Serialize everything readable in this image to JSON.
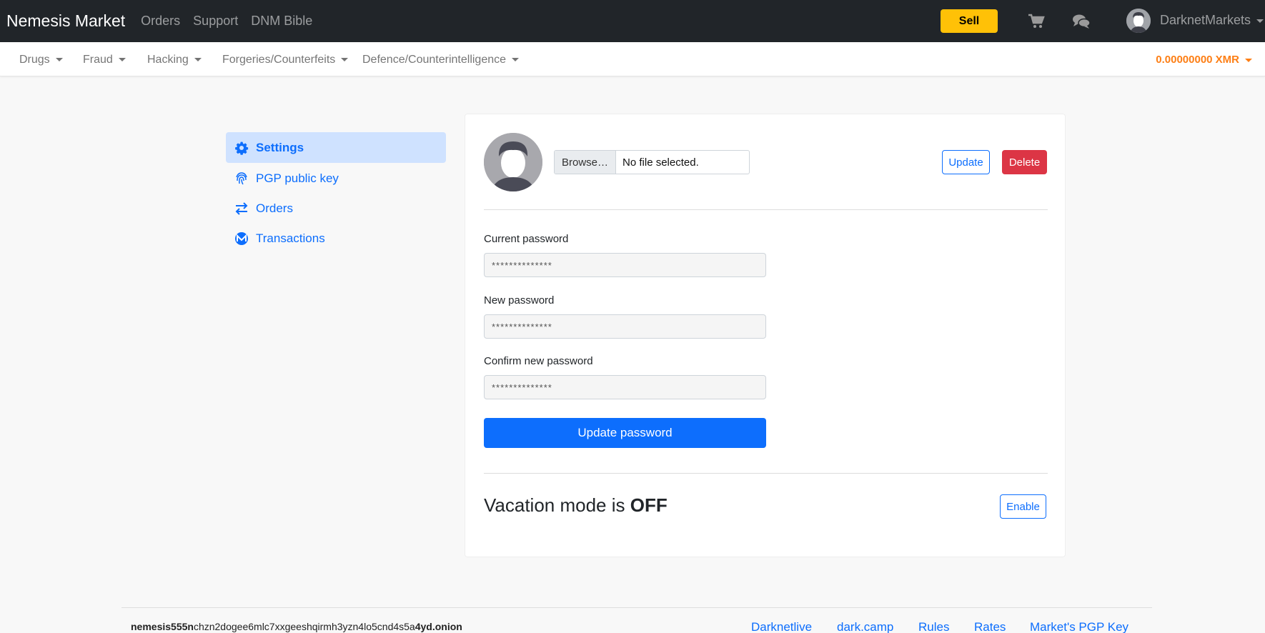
{
  "topnav": {
    "brand": "Nemesis Market",
    "links": [
      "Orders",
      "Support",
      "DNM Bible"
    ],
    "sell_label": "Sell",
    "username": "DarknetMarkets"
  },
  "categories": [
    "Drugs",
    "Fraud",
    "Hacking",
    "Forgeries/Counterfeits",
    "Defence/Counterintelligence"
  ],
  "balance": "0.00000000 XMR",
  "sidebar": {
    "items": [
      {
        "label": "Settings",
        "icon": "gear-icon",
        "active": true
      },
      {
        "label": "PGP public key",
        "icon": "fingerprint-icon"
      },
      {
        "label": "Orders",
        "icon": "exchange-arrows-icon"
      },
      {
        "label": "Transactions",
        "icon": "monero-icon"
      }
    ]
  },
  "avatar_form": {
    "browse_label": "Browse…",
    "file_status": "No file selected.",
    "update_label": "Update",
    "delete_label": "Delete"
  },
  "password_form": {
    "current_label": "Current password",
    "current_placeholder": "**************",
    "new_label": "New password",
    "new_placeholder": "**************",
    "confirm_label": "Confirm new password",
    "confirm_placeholder": "**************",
    "submit_label": "Update password"
  },
  "vacation": {
    "prefix": "Vacation mode is ",
    "state": "OFF",
    "button_label": "Enable"
  },
  "footer": {
    "onion_start": "nemesis555n",
    "onion_middle": "chzn2dogee6mlc7xxgeeshqirmh3yzn4lo5cnd4s5a",
    "onion_end": "4yd.onion",
    "links": [
      "Darknetlive",
      "dark.camp",
      "Rules",
      "Rates",
      "Market's PGP Key"
    ]
  },
  "colors": {
    "navbar": "#212529",
    "primary": "#0d6efd",
    "sell": "#ffc107",
    "danger": "#dc3545",
    "balance": "#fd7e14"
  }
}
